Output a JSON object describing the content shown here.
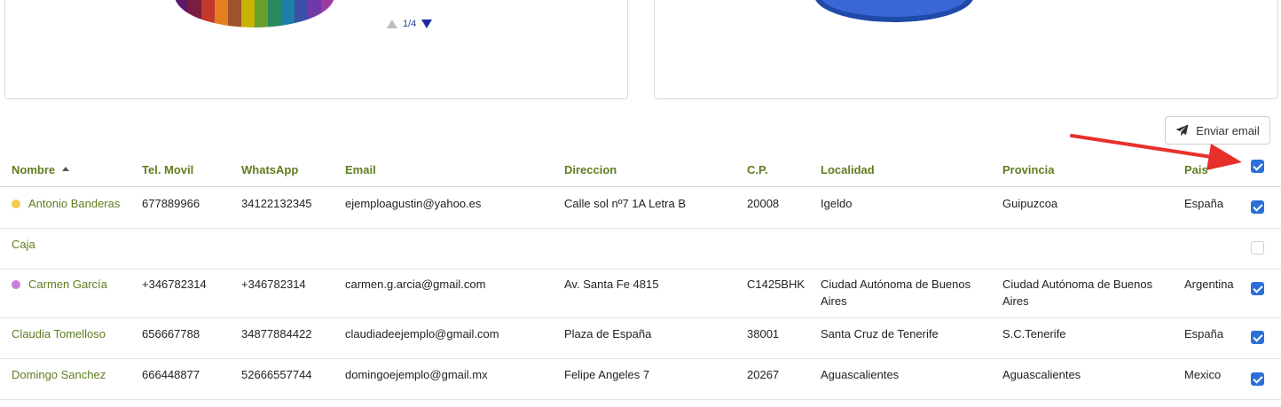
{
  "charts": {
    "pager": {
      "current": "1/4"
    },
    "colors": {
      "pie_slices": [
        "#5b1a6e",
        "#7a1e3d",
        "#c0392b",
        "#e67e22",
        "#a0522d",
        "#c8b400",
        "#6a9f2a",
        "#2a8a5e",
        "#1e7ea8",
        "#3c4fa8",
        "#6f3aa8",
        "#9b3aa0"
      ],
      "dome_outer": "#1f4aa8",
      "dome_inner": "#3a67d6"
    }
  },
  "toolbar": {
    "send_email_label": "Enviar email",
    "send_icon": "paper-plane-icon"
  },
  "table": {
    "headers": {
      "name": "Nombre",
      "mobile": "Tel. Movil",
      "whatsapp": "WhatsApp",
      "email": "Email",
      "address": "Direccion",
      "postal": "C.P.",
      "city": "Localidad",
      "province": "Provincia",
      "country": "Pais"
    },
    "select_all_checked": true,
    "rows": [
      {
        "name": "Antonio Banderas",
        "dot_color": "#f2cb4c",
        "mobile": "677889966",
        "whatsapp": "34122132345",
        "email": "ejemploagustin@yahoo.es",
        "address": "Calle sol nº7 1A Letra B",
        "postal": "20008",
        "city": "Igeldo",
        "province": "Guipuzcoa",
        "country": "España",
        "checked": true
      },
      {
        "name": "Caja",
        "dot_color": "",
        "mobile": "",
        "whatsapp": "",
        "email": "",
        "address": "",
        "postal": "",
        "city": "",
        "province": "",
        "country": "",
        "checked": false
      },
      {
        "name": "Carmen García",
        "dot_color": "#c77ed9",
        "mobile": "+346782314",
        "whatsapp": "+346782314",
        "email": "carmen.g.arcia@gmail.com",
        "address": "Av. Santa Fe 4815",
        "postal": "C1425BHK",
        "city": "Ciudad Autónoma de Buenos Aires",
        "province": "Ciudad Autónoma de Buenos Aires",
        "country": "Argentina",
        "checked": true
      },
      {
        "name": "Claudia Tomelloso",
        "dot_color": "",
        "mobile": "656667788",
        "whatsapp": "34877884422",
        "email": "claudiadeejemplo@gmail.com",
        "address": "Plaza de España",
        "postal": "38001",
        "city": "Santa Cruz de Tenerife",
        "province": "S.C.Tenerife",
        "country": "España",
        "checked": true
      },
      {
        "name": "Domingo Sanchez",
        "dot_color": "",
        "mobile": "666448877",
        "whatsapp": "52666557744",
        "email": "domingoejemplo@gmail.mx",
        "address": "Felipe Angeles 7",
        "postal": "20267",
        "city": "Aguascalientes",
        "province": "Aguascalientes",
        "country": "Mexico",
        "checked": true
      }
    ]
  },
  "annotation": {
    "arrow_color": "#e8302a"
  }
}
